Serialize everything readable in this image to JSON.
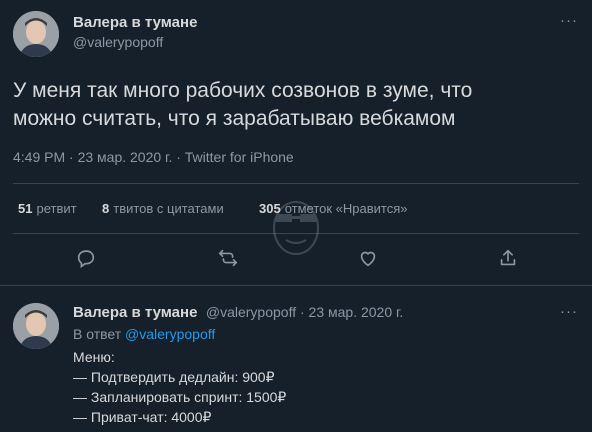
{
  "tweet": {
    "author_name": "Валера в тумане",
    "author_handle": "@valerypopoff",
    "text_line1": "У меня так много рабочих созвонов в зуме, что",
    "text_line2": "можно считать, что я зарабатываю вебкамом",
    "timestamp": "4:49 PM · 23 мар. 2020 г. · Twitter for iPhone",
    "stats": {
      "retweets_count": "51",
      "retweets_label": "ретвит",
      "quotes_count": "8",
      "quotes_label": "твитов с цитатами",
      "likes_count": "305",
      "likes_label": "отметок «Нравится»"
    }
  },
  "reply": {
    "author_name": "Валера в тумане",
    "author_handle": "@valerypopoff · 23 мар. 2020 г.",
    "in_reply_prefix": "В ответ ",
    "in_reply_handle": "@valerypopoff",
    "lines": [
      "Меню:",
      "— Подтвердить дедлайн: 900₽",
      "— Запланировать спринт: 1500₽",
      "— Приват-чат: 4000₽"
    ]
  },
  "icons": [
    "more-icon",
    "reply-icon",
    "retweet-icon",
    "like-icon",
    "share-icon"
  ],
  "colors": {
    "background": "#15202b",
    "text": "#d9d9d9",
    "muted": "#8b98a5",
    "link": "#1d9bf0",
    "divider": "#38444d"
  }
}
